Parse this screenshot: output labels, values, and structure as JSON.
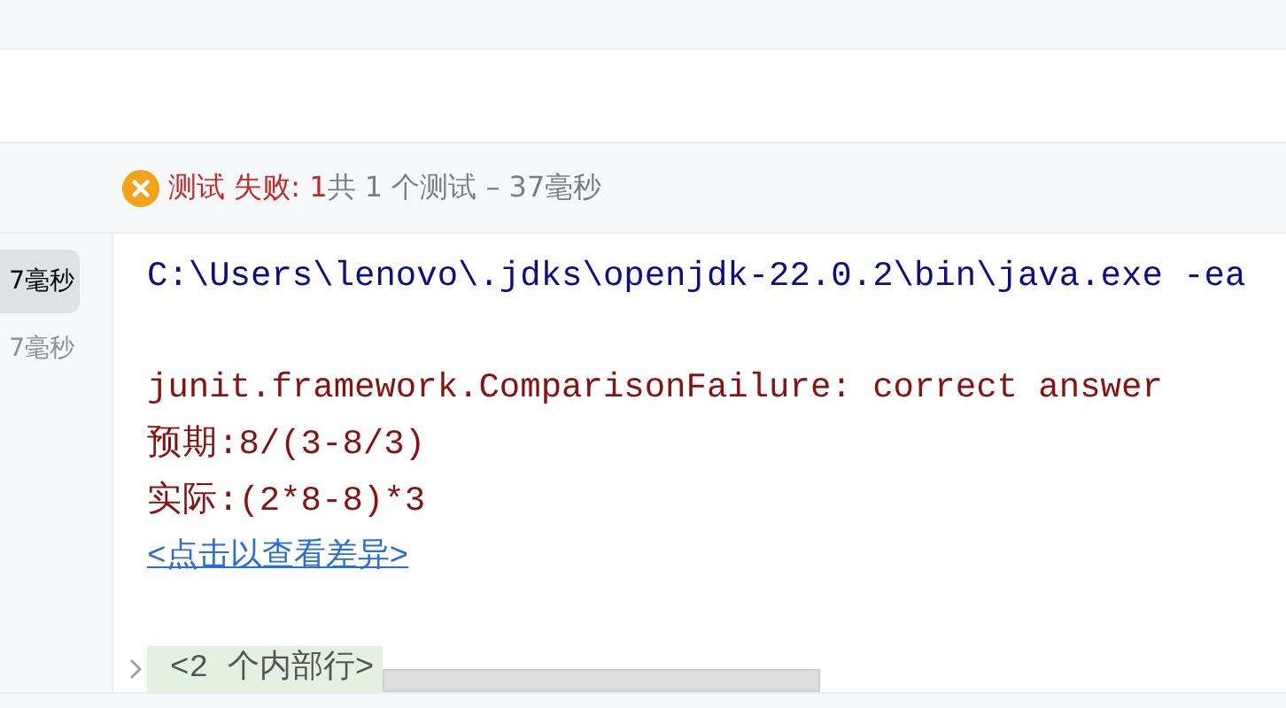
{
  "status": {
    "failed_label": "测试 失败: 1",
    "summary": "共 1 个测试 – 37毫秒"
  },
  "test_list": [
    {
      "duration": "7毫秒",
      "selected": true
    },
    {
      "duration": "7毫秒",
      "selected": false
    }
  ],
  "console": {
    "lines": [
      {
        "kind": "command",
        "text": "C:\\Users\\lenovo\\.jdks\\openjdk-22.0.2\\bin\\java.exe -ea"
      },
      {
        "kind": "blank"
      },
      {
        "kind": "error",
        "text": "junit.framework.ComparisonFailure: correct answer"
      },
      {
        "kind": "error",
        "text": "预期:8/(3-8/3)"
      },
      {
        "kind": "error",
        "text": "实际:(2*8-8)*3"
      },
      {
        "kind": "link",
        "text": "<点击以查看差异>"
      },
      {
        "kind": "blank"
      },
      {
        "kind": "fold",
        "text": "<2 个内部行>",
        "expanded": false
      }
    ]
  }
}
